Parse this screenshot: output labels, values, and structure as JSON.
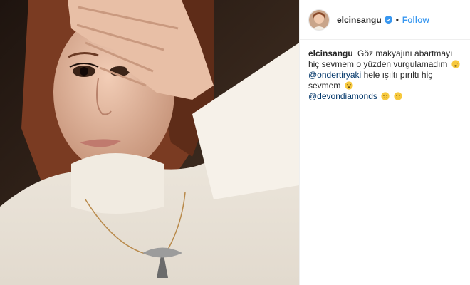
{
  "post": {
    "username": "elcinsangu",
    "follow_label": "Follow",
    "dot": "•",
    "caption": {
      "user": "elcinsangu",
      "line1": "Göz makyajını abartmayı hiç sevmem o yüzden vurgulamadım",
      "mention1": "@ondertiryaki",
      "line2": "hele ışıltı pırıltı hiç sevmem",
      "mention2": "@devondiamonds"
    },
    "icons": {
      "verified": "verified-badge-icon",
      "emoji_a": "weary-face-emoji",
      "emoji_b": "winking-face-emoji"
    },
    "colors": {
      "accent": "#3897f0",
      "mention": "#003569",
      "text": "#262626",
      "border": "#efefef"
    }
  }
}
